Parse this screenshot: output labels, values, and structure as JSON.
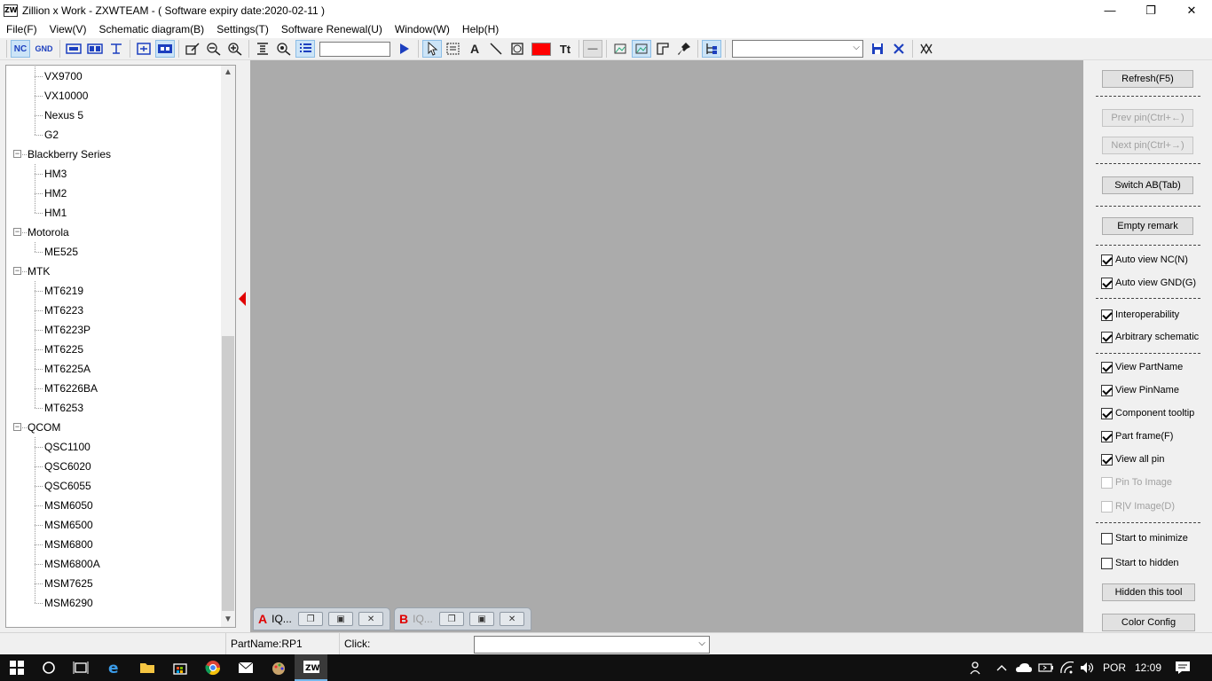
{
  "window": {
    "app_icon": "ZW",
    "title": "Zillion x Work - ZXWTEAM - ( Software expiry date:2020-02-11 )",
    "minimize": "—",
    "restore": "❐",
    "close": "✕"
  },
  "menu": [
    "File(F)",
    "View(V)",
    "Schematic diagram(B)",
    "Settings(T)",
    "Software Renewal(U)",
    "Window(W)",
    "Help(H)"
  ],
  "toolbar": {
    "nc_label": "NC",
    "gnd_label": "GND",
    "search_value": "",
    "color_value": "#ff0000",
    "net_combo_value": ""
  },
  "tree": {
    "items": [
      {
        "label": "VX9700",
        "level": 2
      },
      {
        "label": "VX10000",
        "level": 2
      },
      {
        "label": "Nexus 5",
        "level": 2
      },
      {
        "label": "G2",
        "level": 2
      },
      {
        "label": "Blackberry Series",
        "level": 1
      },
      {
        "label": "HM3",
        "level": 2
      },
      {
        "label": "HM2",
        "level": 2
      },
      {
        "label": "HM1",
        "level": 2
      },
      {
        "label": "Motorola",
        "level": 1
      },
      {
        "label": "ME525",
        "level": 2
      },
      {
        "label": "MTK",
        "level": 1
      },
      {
        "label": "MT6219",
        "level": 2
      },
      {
        "label": "MT6223",
        "level": 2
      },
      {
        "label": "MT6223P",
        "level": 2
      },
      {
        "label": "MT6225",
        "level": 2
      },
      {
        "label": "MT6225A",
        "level": 2
      },
      {
        "label": "MT6226BA",
        "level": 2
      },
      {
        "label": "MT6253",
        "level": 2
      },
      {
        "label": "QCOM",
        "level": 1
      },
      {
        "label": "QSC1100",
        "level": 2
      },
      {
        "label": "QSC6020",
        "level": 2
      },
      {
        "label": "QSC6055",
        "level": 2
      },
      {
        "label": "MSM6050",
        "level": 2
      },
      {
        "label": "MSM6500",
        "level": 2
      },
      {
        "label": "MSM6800",
        "level": 2
      },
      {
        "label": "MSM6800A",
        "level": 2
      },
      {
        "label": "MSM7625",
        "level": 2
      },
      {
        "label": "MSM6290",
        "level": 2
      }
    ]
  },
  "doc_tabs": [
    {
      "letter": "A",
      "label": "IQ...",
      "dim": false
    },
    {
      "letter": "B",
      "label": "IQ...",
      "dim": true
    }
  ],
  "right_panel": {
    "refresh": "Refresh(F5)",
    "prev_pin": "Prev pin(Ctrl+←)",
    "next_pin": "Next pin(Ctrl+→)",
    "switch_ab": "Switch AB(Tab)",
    "empty_remark": "Empty remark",
    "auto_view_nc": "Auto view NC(N)",
    "auto_view_gnd": "Auto view GND(G)",
    "interoperability": "Interoperability",
    "arbitrary_schematic": "Arbitrary schematic",
    "view_partname": "View PartName",
    "view_pinname": "View PinName",
    "component_tooltip": "Component tooltip",
    "part_frame": "Part frame(F)",
    "view_all_pin": "View all pin",
    "pin_to_image": "Pin To Image",
    "rv_image": "R|V Image(D)",
    "start_minimize": "Start to minimize",
    "start_hidden": "Start to hidden",
    "hidden_tool": "Hidden this tool",
    "color_config": "Color Config",
    "checks": {
      "auto_view_nc": true,
      "auto_view_gnd": true,
      "interoperability": true,
      "arbitrary_schematic": true,
      "view_partname": true,
      "view_pinname": true,
      "component_tooltip": true,
      "part_frame": true,
      "view_all_pin": true,
      "pin_to_image": false,
      "rv_image": false,
      "start_minimize": false,
      "start_hidden": false
    }
  },
  "status": {
    "part_name": "PartName:RP1",
    "click_label": "Click:",
    "click_combo_value": ""
  },
  "taskbar": {
    "language": "POR",
    "time": "12:09"
  }
}
